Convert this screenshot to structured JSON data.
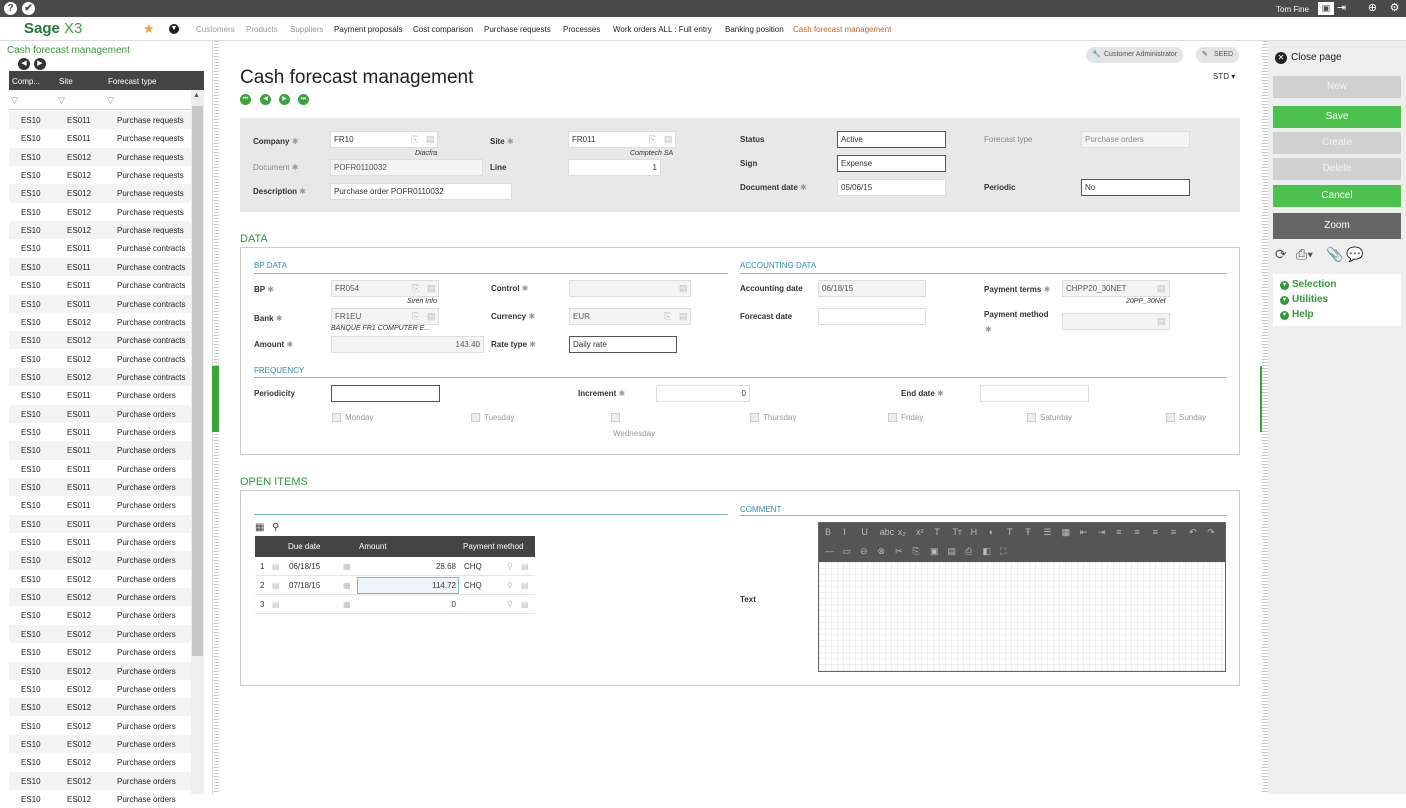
{
  "topbar": {
    "user": "Tom Fine"
  },
  "nav": {
    "logo": "Sage",
    "logo_suffix": "X3",
    "links": [
      {
        "label": "Customers",
        "state": "dim"
      },
      {
        "label": "Products",
        "state": "dim"
      },
      {
        "label": "Suppliers",
        "state": "dim"
      },
      {
        "label": "Payment proposals",
        "state": "normal"
      },
      {
        "label": "Cost comparison",
        "state": "normal"
      },
      {
        "label": "Purchase requests",
        "state": "normal"
      },
      {
        "label": "Processes",
        "state": "normal"
      },
      {
        "label": "Work orders ALL : Full entry",
        "state": "normal"
      },
      {
        "label": "Banking position",
        "state": "normal"
      },
      {
        "label": "Cash forecast management",
        "state": "active"
      }
    ]
  },
  "left": {
    "title": "Cash forecast management",
    "columns": [
      "Comp...",
      "Site",
      "Forecast type"
    ],
    "rows": [
      [
        "ES10",
        "ES011",
        "Purchase requests"
      ],
      [
        "ES10",
        "ES011",
        "Purchase requests"
      ],
      [
        "ES10",
        "ES012",
        "Purchase requests"
      ],
      [
        "ES10",
        "ES012",
        "Purchase requests"
      ],
      [
        "ES10",
        "ES012",
        "Purchase requests"
      ],
      [
        "ES10",
        "ES012",
        "Purchase requests"
      ],
      [
        "ES10",
        "ES012",
        "Purchase requests"
      ],
      [
        "ES10",
        "ES011",
        "Purchase contracts"
      ],
      [
        "ES10",
        "ES011",
        "Purchase contracts"
      ],
      [
        "ES10",
        "ES011",
        "Purchase contracts"
      ],
      [
        "ES10",
        "ES011",
        "Purchase contracts"
      ],
      [
        "ES10",
        "ES012",
        "Purchase contracts"
      ],
      [
        "ES10",
        "ES012",
        "Purchase contracts"
      ],
      [
        "ES10",
        "ES012",
        "Purchase contracts"
      ],
      [
        "ES10",
        "ES012",
        "Purchase contracts"
      ],
      [
        "ES10",
        "ES011",
        "Purchase orders"
      ],
      [
        "ES10",
        "ES011",
        "Purchase orders"
      ],
      [
        "ES10",
        "ES011",
        "Purchase orders"
      ],
      [
        "ES10",
        "ES011",
        "Purchase orders"
      ],
      [
        "ES10",
        "ES011",
        "Purchase orders"
      ],
      [
        "ES10",
        "ES011",
        "Purchase orders"
      ],
      [
        "ES10",
        "ES011",
        "Purchase orders"
      ],
      [
        "ES10",
        "ES011",
        "Purchase orders"
      ],
      [
        "ES10",
        "ES011",
        "Purchase orders"
      ],
      [
        "ES10",
        "ES012",
        "Purchase orders"
      ],
      [
        "ES10",
        "ES012",
        "Purchase orders"
      ],
      [
        "ES10",
        "ES012",
        "Purchase orders"
      ],
      [
        "ES10",
        "ES012",
        "Purchase orders"
      ],
      [
        "ES10",
        "ES012",
        "Purchase orders"
      ],
      [
        "ES10",
        "ES012",
        "Purchase orders"
      ],
      [
        "ES10",
        "ES012",
        "Purchase orders"
      ],
      [
        "ES10",
        "ES012",
        "Purchase orders"
      ],
      [
        "ES10",
        "ES012",
        "Purchase orders"
      ],
      [
        "ES10",
        "ES012",
        "Purchase orders"
      ],
      [
        "ES10",
        "ES012",
        "Purchase orders"
      ],
      [
        "ES10",
        "ES012",
        "Purchase orders"
      ],
      [
        "ES10",
        "ES012",
        "Purchase orders"
      ],
      [
        "ES10",
        "ES012",
        "Purchase orders"
      ]
    ]
  },
  "main": {
    "chips": {
      "admin": "Customer Administrator",
      "seed": "SEED"
    },
    "title": "Cash forecast management",
    "std": "STD",
    "header": {
      "company_label": "Company",
      "company": "FR10",
      "company_sub": "Diacfra",
      "site_label": "Site",
      "site": "FR011",
      "site_sub": "Comptech SA",
      "status_label": "Status",
      "status": "Active",
      "forecast_type_label": "Forecast type",
      "forecast_type": "Purchase orders",
      "document_label": "Document",
      "document": "POFR0110032",
      "line_label": "Line",
      "line": "1",
      "sign_label": "Sign",
      "sign": "Expense",
      "description_label": "Description",
      "description": "Purchase order POFR0110032",
      "document_date_label": "Document date",
      "document_date": "05/06/15",
      "periodic_label": "Periodic",
      "periodic": "No"
    },
    "data_section": {
      "title": "DATA",
      "bp_data_title": "BP DATA",
      "accounting_title": "ACCOUNTING DATA",
      "bp_label": "BP",
      "bp": "FR054",
      "bp_sub": "Siren Info",
      "control_label": "Control",
      "control": "",
      "accounting_date_label": "Accounting date",
      "accounting_date": "06/18/15",
      "payment_terms_label": "Payment terms",
      "payment_terms": "CHPP20_30NET",
      "payment_terms_sub": "20PP_30Net",
      "bank_label": "Bank",
      "bank": "FR1EU",
      "bank_sub": "BANQUE FR1 COMPUTER E...",
      "currency_label": "Currency",
      "currency": "EUR",
      "forecast_date_label": "Forecast date",
      "forecast_date": "",
      "payment_method_label": "Payment method",
      "payment_method": "",
      "amount_label": "Amount",
      "amount": "143.40",
      "rate_type_label": "Rate type",
      "rate_type": "Daily rate",
      "frequency_title": "FREQUENCY",
      "periodicity_label": "Periodicity",
      "periodicity": "",
      "increment_label": "Increment",
      "increment": "0",
      "end_date_label": "End date",
      "end_date": "",
      "days": [
        "Monday",
        "Tuesday",
        "Wednesday",
        "Thursday",
        "Friday",
        "Saturday",
        "Sunday"
      ]
    },
    "open_items": {
      "title": "OPEN ITEMS",
      "comment_title": "COMMENT",
      "text_label": "Text",
      "columns": [
        "Due date",
        "Amount",
        "Payment method"
      ],
      "rows": [
        {
          "n": "1",
          "due": "06/18/15",
          "amount": "28.68",
          "method": "CHQ"
        },
        {
          "n": "2",
          "due": "07/18/15",
          "amount": "114.72",
          "method": "CHQ"
        },
        {
          "n": "3",
          "due": "",
          "amount": "0",
          "method": ""
        }
      ]
    }
  },
  "right": {
    "close_page": "Close page",
    "buttons": {
      "new": "New",
      "save": "Save",
      "create": "Create",
      "delete": "Delete",
      "cancel": "Cancel",
      "zoom": "Zoom"
    },
    "menu": {
      "selection": "Selection",
      "utilities": "Utilities",
      "help": "Help"
    }
  },
  "colors": {
    "brand_green": "#3aa33a",
    "section_green": "#2f9a3a",
    "sub_blue": "#2a8fbf",
    "active_link": "#d4601c",
    "topbar": "#4a4a4a"
  }
}
